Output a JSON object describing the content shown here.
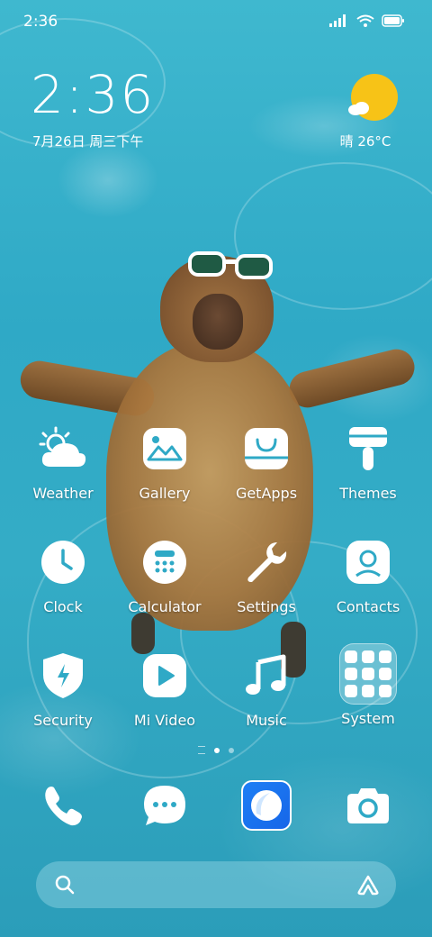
{
  "status_bar": {
    "time": "2:36"
  },
  "clock_widget": {
    "time": "2:36",
    "date": "7月26日 周三下午"
  },
  "weather_widget": {
    "condition_temp": "晴 26°C"
  },
  "apps": [
    {
      "label": "Weather"
    },
    {
      "label": "Gallery"
    },
    {
      "label": "GetApps"
    },
    {
      "label": "Themes"
    },
    {
      "label": "Clock"
    },
    {
      "label": "Calculator"
    },
    {
      "label": "Settings"
    },
    {
      "label": "Contacts"
    },
    {
      "label": "Security"
    },
    {
      "label": "Mi Video"
    },
    {
      "label": "Music"
    },
    {
      "label": "System"
    }
  ],
  "dock": [
    "phone-icon",
    "messages-icon",
    "browser-icon",
    "camera-icon"
  ],
  "page_indicator": {
    "pages": 2,
    "active": 1
  },
  "colors": {
    "water": "#2fa9c6",
    "sun": "#f7c317",
    "browser": "#1d7ff5"
  }
}
